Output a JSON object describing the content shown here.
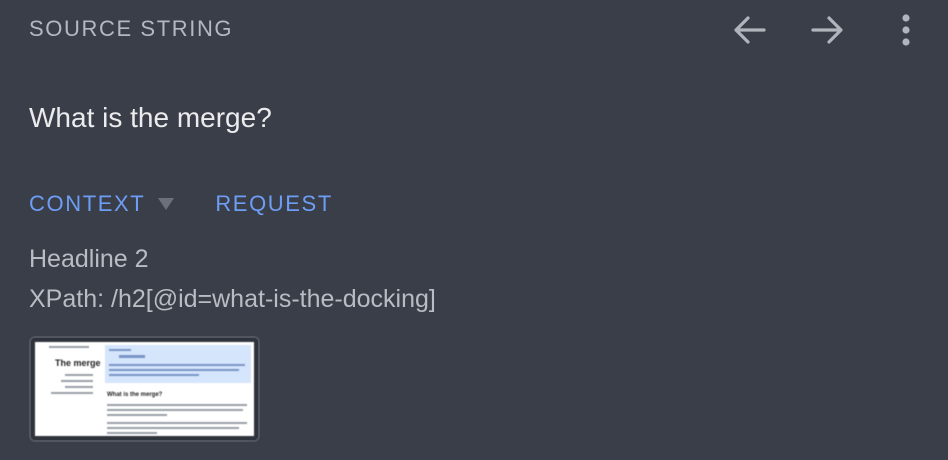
{
  "header": {
    "section_label": "SOURCE STRING",
    "icons": {
      "back": "arrow-left-icon",
      "forward": "arrow-right-icon",
      "more": "more-vertical-icon"
    }
  },
  "source": {
    "text": "What is the merge?"
  },
  "tabs": [
    {
      "label": "CONTEXT",
      "has_dropdown": true,
      "active": true
    },
    {
      "label": "REQUEST",
      "has_dropdown": false,
      "active": false
    }
  ],
  "context": {
    "element_type": "Headline 2",
    "xpath": "XPath: /h2[@id=what-is-the-docking]",
    "screenshot": {
      "title": "The merge",
      "heading": "What is the merge?"
    }
  },
  "colors": {
    "background": "#393e49",
    "label": "#b4b8c0",
    "text": "#ececee",
    "accent": "#6e9df5",
    "secondary_text": "#b9bcc3",
    "icon": "#b0b4bc"
  }
}
